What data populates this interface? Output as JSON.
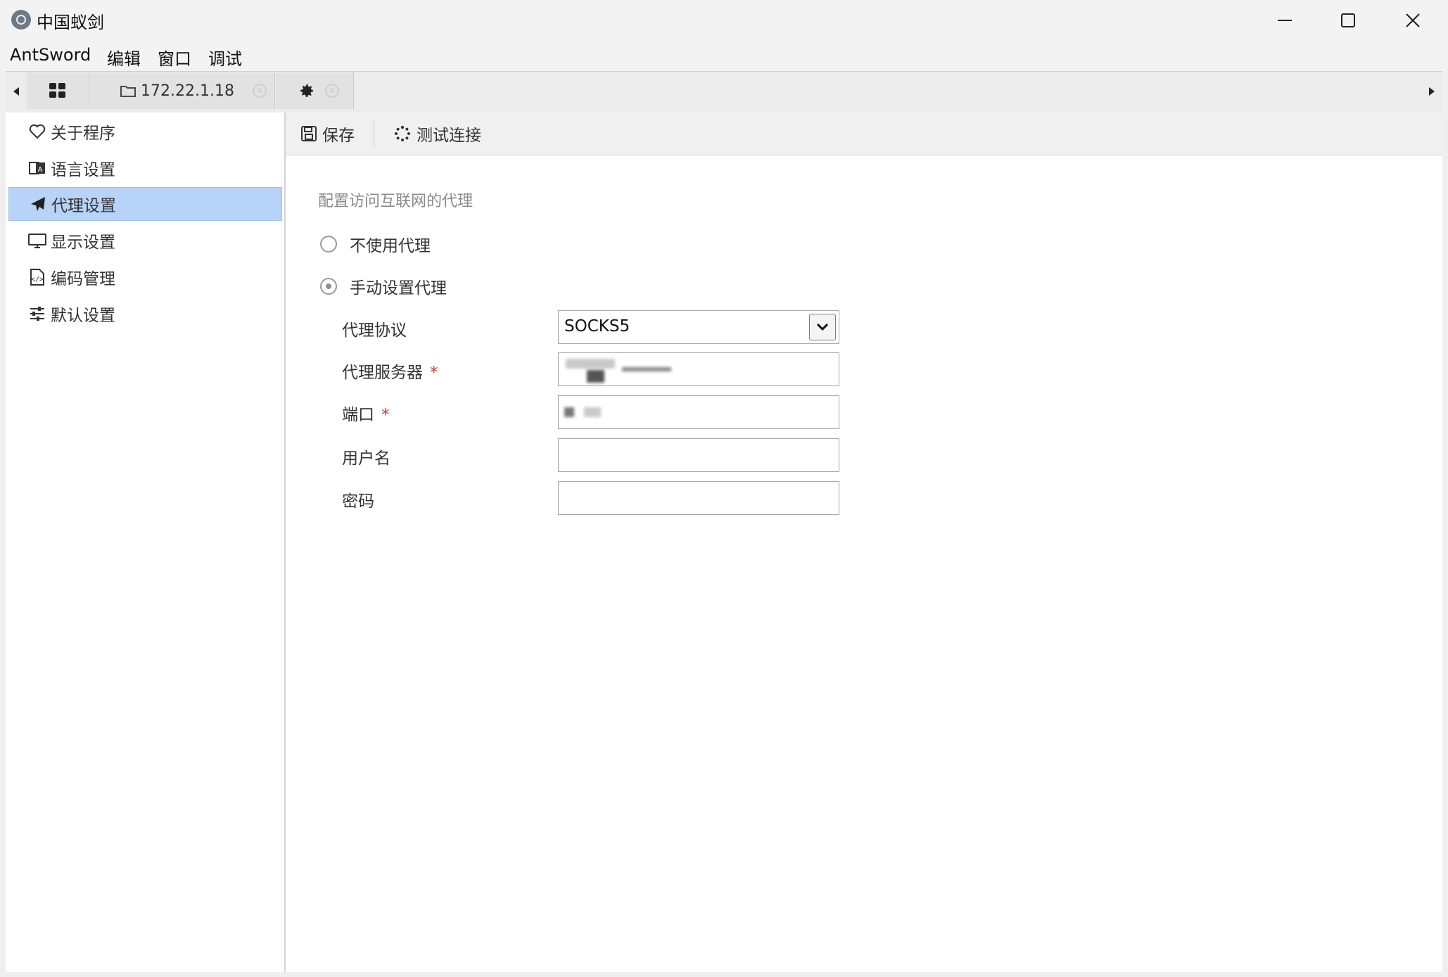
{
  "window": {
    "title": "中国蚁剑",
    "controls": [
      "minimize-icon",
      "maximize-icon",
      "close-icon"
    ]
  },
  "menubar": {
    "items": [
      "AntSword",
      "编辑",
      "窗口",
      "调试"
    ]
  },
  "tabs": [
    {
      "icon": "grid-icon",
      "label": ""
    },
    {
      "icon": "folder-icon",
      "label": "172.22.1.18",
      "closable": true
    },
    {
      "icon": "gear-icon",
      "label": "",
      "closable": true
    }
  ],
  "sidebar": {
    "items": [
      {
        "icon": "heart-icon",
        "label": "关于程序"
      },
      {
        "icon": "language-icon",
        "label": "语言设置"
      },
      {
        "icon": "paper-plane-icon",
        "label": "代理设置",
        "active": true
      },
      {
        "icon": "monitor-icon",
        "label": "显示设置"
      },
      {
        "icon": "code-file-icon",
        "label": "编码管理"
      },
      {
        "icon": "sliders-icon",
        "label": "默认设置"
      }
    ]
  },
  "toolbar": {
    "save_label": "保存",
    "test_label": "测试连接"
  },
  "form": {
    "legend": "配置访问互联网的代理",
    "radio_no_proxy": "不使用代理",
    "radio_manual_proxy": "手动设置代理",
    "selected_mode": "手动设置代理",
    "fields": {
      "protocol_label": "代理协议",
      "protocol_value": "SOCKS5",
      "server_label": "代理服务器",
      "port_label": "端口",
      "username_label": "用户名",
      "password_label": "密码",
      "required_mark": "*"
    }
  },
  "colors": {
    "active_bg": "#b7d3f7",
    "required": "#dd3333"
  }
}
